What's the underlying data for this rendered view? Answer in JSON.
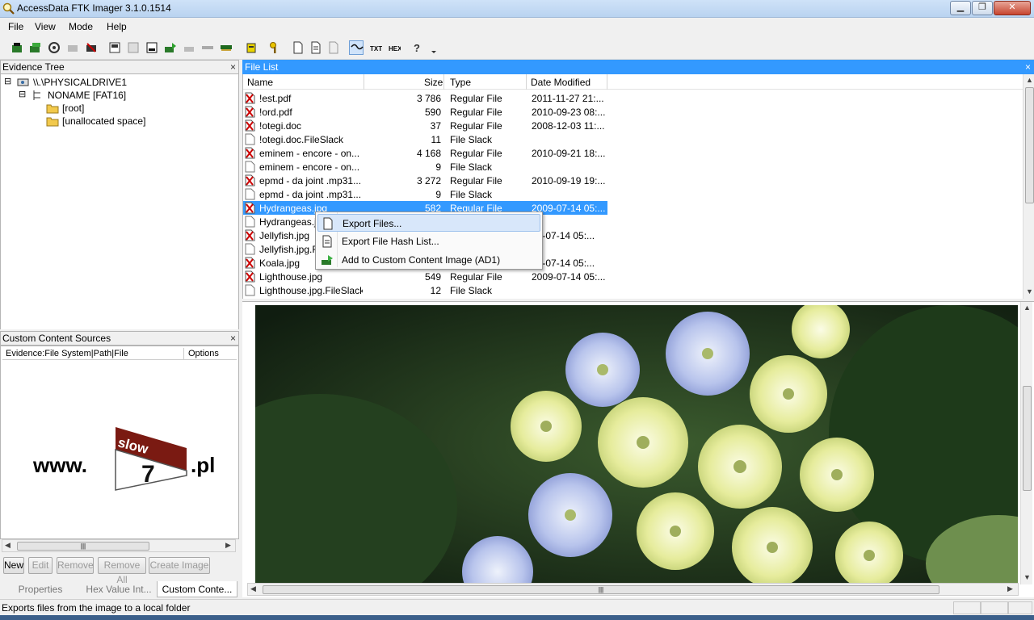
{
  "window": {
    "title": "AccessData FTK Imager 3.1.0.1514"
  },
  "menu": [
    "File",
    "View",
    "Mode",
    "Help"
  ],
  "toolbar": {
    "icons": [
      "add-evidence-icon",
      "add-all-evidence-icon",
      "image-mounting-icon",
      "remove-evidence-icon",
      "remove-all-evidence-icon",
      "create-disk-image-icon",
      "export-disk-image-icon",
      "export-logical-image-icon",
      "add-to-custom-content-icon",
      "create-custom-content-image-icon",
      "decrypt-icon",
      "verify-drive-icon",
      "capture-memory-icon",
      "obtain-protected-files-icon",
      "detect-encryption-icon",
      "export-files-icon",
      "export-hash-list-icon",
      "export-directory-listing-icon",
      "auto-view-icon",
      "text-view-icon",
      "hex-view-icon",
      "help-icon",
      "dropdown-arrow-icon"
    ]
  },
  "evidence_tree": {
    "title": "Evidence Tree",
    "close": "×",
    "nodes": [
      {
        "label": "\\\\.\\PHYSICALDRIVE1",
        "expander": "⊟"
      },
      {
        "label": "NONAME [FAT16]",
        "expander": "⊟"
      },
      {
        "label": "[root]"
      },
      {
        "label": "[unallocated space]"
      }
    ]
  },
  "file_list": {
    "title": "File List",
    "close": "×",
    "columns": {
      "name": "Name",
      "size": "Size",
      "type": "Type",
      "date": "Date Modified"
    },
    "rows": [
      {
        "name": "!est.pdf",
        "size": "3 786",
        "type": "Regular File",
        "date": "2011-11-27 21:...",
        "deleted": true
      },
      {
        "name": "!ord.pdf",
        "size": "590",
        "type": "Regular File",
        "date": "2010-09-23 08:...",
        "deleted": true
      },
      {
        "name": "!otegi.doc",
        "size": "37",
        "type": "Regular File",
        "date": "2008-12-03 11:...",
        "deleted": true
      },
      {
        "name": "!otegi.doc.FileSlack",
        "size": "11",
        "type": "File Slack",
        "date": "",
        "deleted": false
      },
      {
        "name": "eminem - encore - on...",
        "size": "4 168",
        "type": "Regular File",
        "date": "2010-09-21 18:...",
        "deleted": true
      },
      {
        "name": "eminem - encore - on...",
        "size": "9",
        "type": "File Slack",
        "date": "",
        "deleted": false
      },
      {
        "name": "epmd - da joint .mp31...",
        "size": "3 272",
        "type": "Regular File",
        "date": "2010-09-19 19:...",
        "deleted": true
      },
      {
        "name": "epmd - da joint .mp31...",
        "size": "9",
        "type": "File Slack",
        "date": "",
        "deleted": false
      },
      {
        "name": "Hydrangeas.jpg",
        "size": "582",
        "type": "Regular File",
        "date": "2009-07-14 05:...",
        "deleted": true
      },
      {
        "name": "Hydrangeas.jpg.FileSlack",
        "size": "",
        "type": "",
        "date": "",
        "deleted": false
      },
      {
        "name": "Jellyfish.jpg",
        "size": "",
        "type": "",
        "date": "09-07-14 05:...",
        "deleted": true
      },
      {
        "name": "Jellyfish.jpg.FileSlack",
        "size": "",
        "type": "",
        "date": "",
        "deleted": false
      },
      {
        "name": "Koala.jpg",
        "size": "",
        "type": "",
        "date": "09-07-14 05:...",
        "deleted": true
      },
      {
        "name": "Lighthouse.jpg",
        "size": "549",
        "type": "Regular File",
        "date": "2009-07-14 05:...",
        "deleted": true
      },
      {
        "name": "Lighthouse.jpg.FileSlack",
        "size": "12",
        "type": "File Slack",
        "date": "",
        "deleted": false
      }
    ],
    "selected_index": 8
  },
  "context_menu": {
    "items": [
      {
        "label": "Export Files...",
        "icon": "export-files-icon"
      },
      {
        "label": "Export File Hash List...",
        "icon": "hash-list-icon"
      },
      {
        "label": "Add to Custom Content Image (AD1)",
        "icon": "add-custom-content-icon"
      }
    ],
    "highlighted_index": 0
  },
  "custom_content": {
    "title": "Custom Content Sources",
    "close": "×",
    "col_evidence": "Evidence:File System|Path|File",
    "col_options": "Options",
    "watermark": {
      "prefix": "www.",
      "badge_top": "slow",
      "badge_num": "7",
      "suffix": ".pl"
    },
    "scroll_grip": "|||",
    "buttons": [
      "New",
      "Edit",
      "Remove",
      "Remove All",
      "Create Image"
    ],
    "buttons_enabled": [
      true,
      false,
      false,
      false,
      false
    ]
  },
  "bottom_tabs": [
    "Properties",
    "Hex Value Int...",
    "Custom Conte..."
  ],
  "active_bottom_tab": 2,
  "viewer": {
    "scroll_grip": "|||",
    "image_subject": "hydrangea flowers"
  },
  "status": {
    "message": "Exports files from the image to a local folder"
  },
  "colors": {
    "selection": "#3399ff",
    "deleted_mark": "#cc0000",
    "menu_highlight": "#d8e7fa"
  }
}
